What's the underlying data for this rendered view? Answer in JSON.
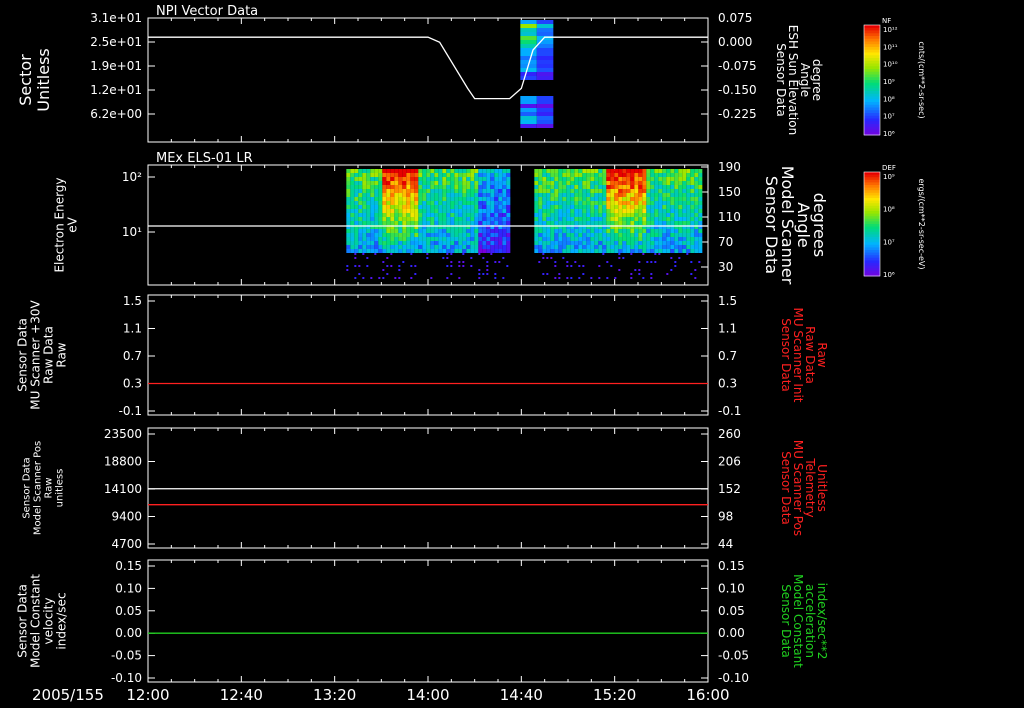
{
  "colors": {
    "background": "#000000",
    "axis": "#ffffff",
    "red": "#ff2020",
    "green": "#20d020",
    "white": "#ffffff"
  },
  "x_axis": {
    "date_label": "2005/155",
    "ticks": [
      "12:00",
      "12:40",
      "13:20",
      "14:00",
      "14:40",
      "15:20",
      "16:00"
    ],
    "range_minutes": [
      0,
      240
    ],
    "tick_minutes": [
      0,
      40,
      80,
      120,
      160,
      200,
      240
    ]
  },
  "colorbars": [
    {
      "label": "NF",
      "unit": "cnts/(cm**2-sr-sec)",
      "ticks": [
        "10¹²",
        "10¹¹",
        "10¹⁰",
        "10⁹",
        "10⁸",
        "10⁷",
        "10⁶"
      ]
    },
    {
      "label": "DEF",
      "unit": "ergs/(cm**2-sr-sec-eV)",
      "ticks": [
        "10⁹",
        "10⁸",
        "10⁷",
        "10⁶"
      ]
    }
  ],
  "chart_data": [
    {
      "type": "line",
      "title": "NPI Vector Data",
      "ylabel": [
        "Sector",
        "Unitless"
      ],
      "yticks": [
        "3.1e+01",
        "2.5e+01",
        "1.9e+01",
        "1.2e+01",
        "6.2e+00"
      ],
      "y2label": [
        "Sensor Data",
        "ESH Sun Elevation",
        "Angle",
        "degree"
      ],
      "y2ticks": [
        "0.075",
        "0.000",
        "-0.075",
        "-0.150",
        "-0.225"
      ],
      "ylim2": [
        -0.3,
        0.075
      ],
      "series": [
        {
          "color": "white",
          "x": [
            0,
            120,
            125,
            137,
            140,
            155,
            160,
            165,
            170,
            240
          ],
          "y": [
            0.0,
            0.0,
            -0.02,
            -0.2,
            -0.24,
            -0.24,
            -0.2,
            -0.05,
            0.0,
            0.0
          ]
        }
      ],
      "spectrogram": {
        "x_range": [
          163,
          178
        ],
        "gaps": [
          [
            156,
            162
          ]
        ]
      }
    },
    {
      "type": "heatmap",
      "title": "MEx ELS-01 LR",
      "ylabel": [
        "Electron Energy",
        "eV"
      ],
      "yticks": [
        "10²",
        "10¹"
      ],
      "y2label": [
        "Sensor Data",
        "Model Scanner",
        "Angle",
        "degrees"
      ],
      "y2ticks": [
        "190",
        "150",
        "110",
        "70",
        "30"
      ],
      "ylim2": [
        0,
        190
      ],
      "data_start_minute": 85,
      "gaps": [
        [
          155,
          161
        ],
        [
          162,
          164
        ]
      ],
      "series": [
        {
          "color": "white",
          "x": [
            0,
            240
          ],
          "y": [
            95,
            95
          ]
        }
      ]
    },
    {
      "type": "line",
      "ylabel": [
        "Sensor Data",
        "MU Scanner +30V",
        "Raw Data",
        "Raw"
      ],
      "yticks": [
        "1.5",
        "1.1",
        "0.7",
        "0.3",
        "-0.1"
      ],
      "y2label": [
        "Sensor Data",
        "MU Scanner Init",
        "Raw Data",
        "Raw"
      ],
      "y2ticks": [
        "1.5",
        "1.1",
        "0.7",
        "0.3",
        "-0.1"
      ],
      "ylim": [
        -0.5,
        1.5
      ],
      "label_color": "red",
      "series": [
        {
          "color": "red",
          "x": [
            0,
            240
          ],
          "y": [
            0.0,
            0.0
          ]
        }
      ]
    },
    {
      "type": "line",
      "ylabel": [
        "Sensor Data",
        "Model Scanner Pos",
        "Raw",
        "unitless"
      ],
      "yticks": [
        "23500",
        "18800",
        "14100",
        "9400",
        "4700"
      ],
      "y2label": [
        "Sensor Data",
        "MU Scanner Pos",
        "Telemetry",
        "Unitless"
      ],
      "y2ticks": [
        "260",
        "206",
        "152",
        "98",
        "44"
      ],
      "ylim": [
        0,
        23500
      ],
      "label_color": "red",
      "series": [
        {
          "color": "white",
          "x": [
            0,
            240
          ],
          "y": [
            11800,
            11800
          ]
        },
        {
          "color": "red",
          "x": [
            0,
            240
          ],
          "y": [
            8400,
            8400
          ]
        }
      ]
    },
    {
      "type": "line",
      "ylabel": [
        "Sensor Data",
        "Model Constant",
        "velocity",
        "index/sec"
      ],
      "yticks": [
        "0.15",
        "0.10",
        "0.05",
        "0.00",
        "-0.05",
        "-0.10"
      ],
      "y2label": [
        "Sensor Data",
        "Model Constant",
        "acceleration",
        "index/sec**2"
      ],
      "y2ticks": [
        "0.15",
        "0.10",
        "0.05",
        "0.00",
        "-0.05",
        "-0.10"
      ],
      "ylim": [
        -0.1,
        0.15
      ],
      "label_color": "green",
      "series": [
        {
          "color": "green",
          "x": [
            0,
            240
          ],
          "y": [
            0.0,
            0.0
          ]
        }
      ]
    }
  ]
}
